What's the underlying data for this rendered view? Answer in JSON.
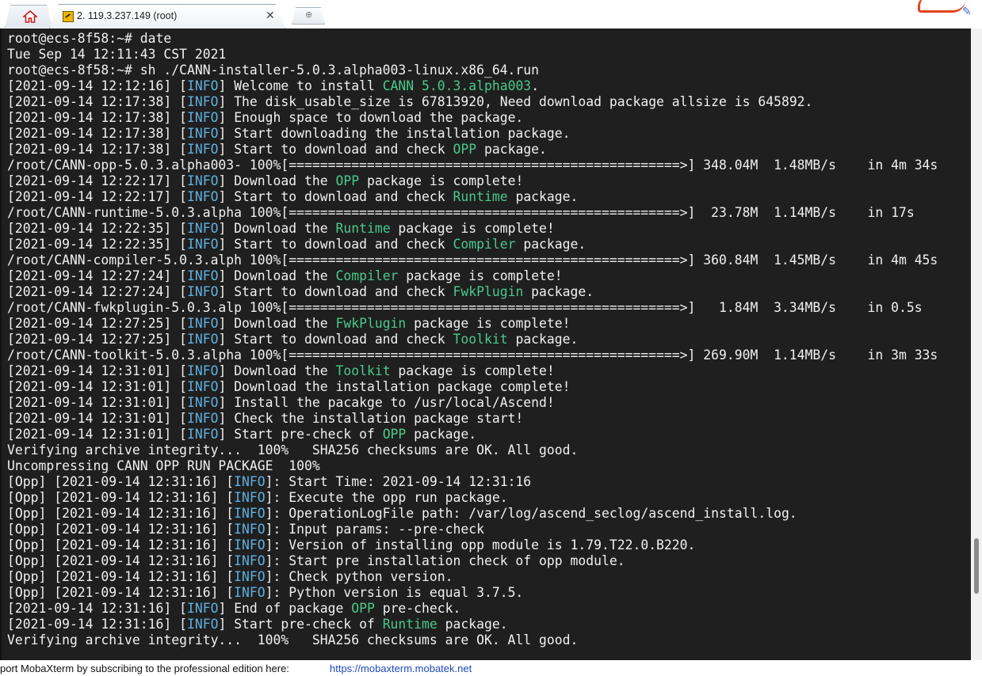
{
  "tab": {
    "title": "2. 119.3.237.149 (root)",
    "close_label": "✕",
    "new_tab_label": "⊕"
  },
  "terminal": {
    "lines": [
      [
        {
          "t": "root@ecs-8f58:~# date"
        }
      ],
      [
        {
          "t": "Tue Sep 14 12:11:43 CST 2021"
        }
      ],
      [
        {
          "t": "root@ecs-8f58:~# sh ./CANN-installer-5.0.3.alpha003-linux.x86_64.run"
        }
      ],
      [
        {
          "t": "[2021-09-14 12:12:16] ["
        },
        {
          "t": "INFO",
          "c": "info"
        },
        {
          "t": "] Welcome to install "
        },
        {
          "t": "CANN 5.0.3.alpha003",
          "c": "hl"
        },
        {
          "t": "."
        }
      ],
      [
        {
          "t": "[2021-09-14 12:17:38] ["
        },
        {
          "t": "INFO",
          "c": "info"
        },
        {
          "t": "] The disk_usable_size is 67813920, Need download package allsize is 645892."
        }
      ],
      [
        {
          "t": "[2021-09-14 12:17:38] ["
        },
        {
          "t": "INFO",
          "c": "info"
        },
        {
          "t": "] Enough space to download the package."
        }
      ],
      [
        {
          "t": "[2021-09-14 12:17:38] ["
        },
        {
          "t": "INFO",
          "c": "info"
        },
        {
          "t": "] Start downloading the installation package."
        }
      ],
      [
        {
          "t": "[2021-09-14 12:17:38] ["
        },
        {
          "t": "INFO",
          "c": "info"
        },
        {
          "t": "] Start to download and check "
        },
        {
          "t": "OPP",
          "c": "hl"
        },
        {
          "t": " package."
        }
      ],
      [
        {
          "t": "/root/CANN-opp-5.0.3.alpha003- 100%[==================================================>] 348.04M  1.48MB/s    in 4m 34s"
        }
      ],
      [
        {
          "t": "[2021-09-14 12:22:17] ["
        },
        {
          "t": "INFO",
          "c": "info"
        },
        {
          "t": "] Download the "
        },
        {
          "t": "OPP",
          "c": "hl"
        },
        {
          "t": " package is complete!"
        }
      ],
      [
        {
          "t": "[2021-09-14 12:22:17] ["
        },
        {
          "t": "INFO",
          "c": "info"
        },
        {
          "t": "] Start to download and check "
        },
        {
          "t": "Runtime",
          "c": "hl"
        },
        {
          "t": " package."
        }
      ],
      [
        {
          "t": "/root/CANN-runtime-5.0.3.alpha 100%[==================================================>]  23.78M  1.14MB/s    in 17s"
        }
      ],
      [
        {
          "t": "[2021-09-14 12:22:35] ["
        },
        {
          "t": "INFO",
          "c": "info"
        },
        {
          "t": "] Download the "
        },
        {
          "t": "Runtime",
          "c": "hl"
        },
        {
          "t": " package is complete!"
        }
      ],
      [
        {
          "t": "[2021-09-14 12:22:35] ["
        },
        {
          "t": "INFO",
          "c": "info"
        },
        {
          "t": "] Start to download and check "
        },
        {
          "t": "Compiler",
          "c": "hl"
        },
        {
          "t": " package."
        }
      ],
      [
        {
          "t": "/root/CANN-compiler-5.0.3.alph 100%[==================================================>] 360.84M  1.45MB/s    in 4m 45s"
        }
      ],
      [
        {
          "t": "[2021-09-14 12:27:24] ["
        },
        {
          "t": "INFO",
          "c": "info"
        },
        {
          "t": "] Download the "
        },
        {
          "t": "Compiler",
          "c": "hl"
        },
        {
          "t": " package is complete!"
        }
      ],
      [
        {
          "t": "[2021-09-14 12:27:24] ["
        },
        {
          "t": "INFO",
          "c": "info"
        },
        {
          "t": "] Start to download and check "
        },
        {
          "t": "FwkPlugin",
          "c": "hl"
        },
        {
          "t": " package."
        }
      ],
      [
        {
          "t": "/root/CANN-fwkplugin-5.0.3.alp 100%[==================================================>]   1.84M  3.34MB/s    in 0.5s"
        }
      ],
      [
        {
          "t": "[2021-09-14 12:27:25] ["
        },
        {
          "t": "INFO",
          "c": "info"
        },
        {
          "t": "] Download the "
        },
        {
          "t": "FwkPlugin",
          "c": "hl"
        },
        {
          "t": " package is complete!"
        }
      ],
      [
        {
          "t": "[2021-09-14 12:27:25] ["
        },
        {
          "t": "INFO",
          "c": "info"
        },
        {
          "t": "] Start to download and check "
        },
        {
          "t": "Toolkit",
          "c": "hl"
        },
        {
          "t": " package."
        }
      ],
      [
        {
          "t": "/root/CANN-toolkit-5.0.3.alpha 100%[==================================================>] 269.90M  1.14MB/s    in 3m 33s"
        }
      ],
      [
        {
          "t": "[2021-09-14 12:31:01] ["
        },
        {
          "t": "INFO",
          "c": "info"
        },
        {
          "t": "] Download the "
        },
        {
          "t": "Toolkit",
          "c": "hl"
        },
        {
          "t": " package is complete!"
        }
      ],
      [
        {
          "t": "[2021-09-14 12:31:01] ["
        },
        {
          "t": "INFO",
          "c": "info"
        },
        {
          "t": "] Download the installation package complete!"
        }
      ],
      [
        {
          "t": "[2021-09-14 12:31:01] ["
        },
        {
          "t": "INFO",
          "c": "info"
        },
        {
          "t": "] Install the pacakge to /usr/local/Ascend!"
        }
      ],
      [
        {
          "t": "[2021-09-14 12:31:01] ["
        },
        {
          "t": "INFO",
          "c": "info"
        },
        {
          "t": "] Check the installation package start!"
        }
      ],
      [
        {
          "t": "[2021-09-14 12:31:01] ["
        },
        {
          "t": "INFO",
          "c": "info"
        },
        {
          "t": "] Start pre-check of "
        },
        {
          "t": "OPP",
          "c": "hl"
        },
        {
          "t": " package."
        }
      ],
      [
        {
          "t": "Verifying archive integrity...  100%   SHA256 checksums are OK. All good."
        }
      ],
      [
        {
          "t": "Uncompressing CANN OPP RUN PACKAGE  100%"
        }
      ],
      [
        {
          "t": "[Opp] [2021-09-14 12:31:16] ["
        },
        {
          "t": "INFO",
          "c": "info"
        },
        {
          "t": "]: Start Time: 2021-09-14 12:31:16"
        }
      ],
      [
        {
          "t": "[Opp] [2021-09-14 12:31:16] ["
        },
        {
          "t": "INFO",
          "c": "info"
        },
        {
          "t": "]: Execute the opp run package."
        }
      ],
      [
        {
          "t": "[Opp] [2021-09-14 12:31:16] ["
        },
        {
          "t": "INFO",
          "c": "info"
        },
        {
          "t": "]: OperationLogFile path: /var/log/ascend_seclog/ascend_install.log."
        }
      ],
      [
        {
          "t": "[Opp] [2021-09-14 12:31:16] ["
        },
        {
          "t": "INFO",
          "c": "info"
        },
        {
          "t": "]: Input params: --pre-check"
        }
      ],
      [
        {
          "t": "[Opp] [2021-09-14 12:31:16] ["
        },
        {
          "t": "INFO",
          "c": "info"
        },
        {
          "t": "]: Version of installing opp module is 1.79.T22.0.B220."
        }
      ],
      [
        {
          "t": "[Opp] [2021-09-14 12:31:16] ["
        },
        {
          "t": "INFO",
          "c": "info"
        },
        {
          "t": "]: Start pre installation check of opp module."
        }
      ],
      [
        {
          "t": "[Opp] [2021-09-14 12:31:16] ["
        },
        {
          "t": "INFO",
          "c": "info"
        },
        {
          "t": "]: Check python version."
        }
      ],
      [
        {
          "t": "[Opp] [2021-09-14 12:31:16] ["
        },
        {
          "t": "INFO",
          "c": "info"
        },
        {
          "t": "]: Python version is equal 3.7.5."
        }
      ],
      [
        {
          "t": "[2021-09-14 12:31:16] ["
        },
        {
          "t": "INFO",
          "c": "info"
        },
        {
          "t": "] End of package "
        },
        {
          "t": "OPP",
          "c": "hl"
        },
        {
          "t": " pre-check."
        }
      ],
      [
        {
          "t": "[2021-09-14 12:31:16] ["
        },
        {
          "t": "INFO",
          "c": "info"
        },
        {
          "t": "] Start pre-check of "
        },
        {
          "t": "Runtime",
          "c": "hl"
        },
        {
          "t": " package."
        }
      ],
      [
        {
          "t": "Verifying archive integrity...  100%   SHA256 checksums are OK. All good."
        }
      ]
    ]
  },
  "statusbar": {
    "message": "port MobaXterm by subscribing to the professional edition here:",
    "link": "https://mobaxterm.mobatek.net"
  },
  "icons": {
    "home": "home-icon",
    "session": "terminal-session-icon",
    "close": "close-icon",
    "new_tab": "new-tab-icon"
  },
  "colors": {
    "terminal_bg": "#1f1f1f",
    "terminal_fg": "#f0f0f0",
    "highlight_green": "#49c98b",
    "info_blue": "#5fb0df",
    "link_blue": "#1f49b8"
  }
}
